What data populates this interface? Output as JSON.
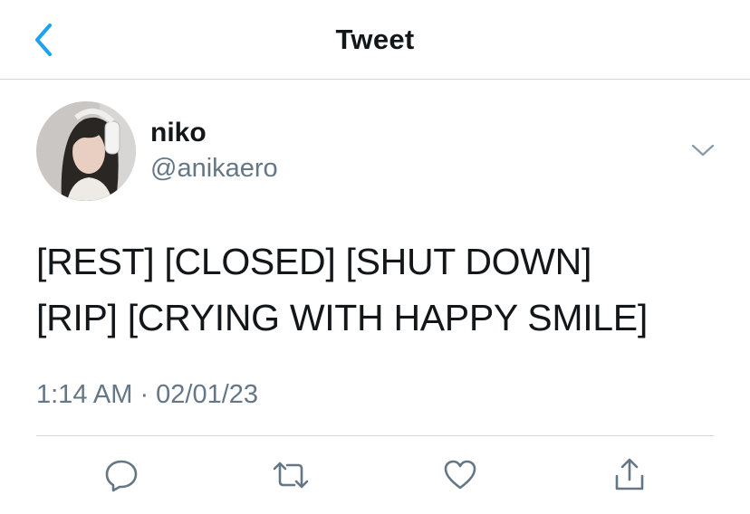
{
  "header": {
    "title": "Tweet",
    "back_icon": "chevron-left-icon"
  },
  "colors": {
    "accent": "#1da1f2",
    "text": "#14171a",
    "secondary": "#657786",
    "divider": "#d3d6d9"
  },
  "tweet": {
    "author": {
      "name": "niko",
      "handle": "@anikaero",
      "avatar": "profile-photo"
    },
    "text_lines": [
      "[REST] [CLOSED] [SHUT DOWN]",
      "[RIP] [CRYING WITH HAPPY SMILE]"
    ],
    "timestamp": "1:14 AM · 02/01/23"
  },
  "actions": [
    "reply-icon",
    "retweet-icon",
    "like-icon",
    "share-icon"
  ]
}
